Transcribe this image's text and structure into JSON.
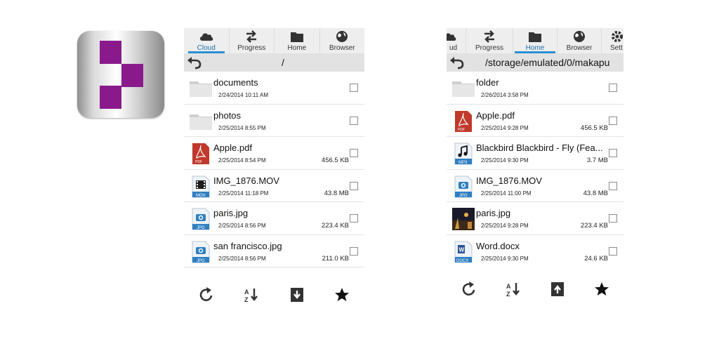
{
  "left_panel": {
    "tabs": [
      {
        "label": "Cloud",
        "icon": "cloud-icon",
        "active": true
      },
      {
        "label": "Progress",
        "icon": "transfer-arrows-icon",
        "active": false
      },
      {
        "label": "Home",
        "icon": "folder-icon",
        "active": false
      },
      {
        "label": "Browser",
        "icon": "globe-icon",
        "active": false
      }
    ],
    "path": "/",
    "files": [
      {
        "name": "documents",
        "date": "2/24/2014 10:11 AM",
        "size": "",
        "icon": "folder-icon"
      },
      {
        "name": "photos",
        "date": "2/25/2014 8:55 PM",
        "size": "",
        "icon": "folder-icon"
      },
      {
        "name": "Apple.pdf",
        "date": "2/25/2014 8:54 PM",
        "size": "456.5 KB",
        "icon": "pdf-file-icon"
      },
      {
        "name": "IMG_1876.MOV",
        "date": "2/25/2014 11:18 PM",
        "size": "43.8 MB",
        "icon": "mov-file-icon"
      },
      {
        "name": "paris.jpg",
        "date": "2/25/2014 8:56 PM",
        "size": "223.4 KB",
        "icon": "jpg-file-icon"
      },
      {
        "name": "san francisco.jpg",
        "date": "2/25/2014 8:56 PM",
        "size": "211.0 KB",
        "icon": "jpg-file-icon"
      }
    ],
    "bottom_actions": [
      "refresh-icon",
      "sort-icon",
      "download-icon",
      "star-icon"
    ]
  },
  "right_panel": {
    "tabs": [
      {
        "label": "ud",
        "icon": "cloud-icon",
        "active": false
      },
      {
        "label": "Progress",
        "icon": "transfer-arrows-icon",
        "active": false
      },
      {
        "label": "Home",
        "icon": "folder-icon",
        "active": true
      },
      {
        "label": "Browser",
        "icon": "globe-icon",
        "active": false
      },
      {
        "label": "Sett",
        "icon": "gear-icon",
        "active": false
      }
    ],
    "path": "/storage/emulated/0/makapu",
    "files": [
      {
        "name": "folder",
        "date": "2/26/2014 3:58 PM",
        "size": "",
        "icon": "folder-icon"
      },
      {
        "name": "Apple.pdf",
        "date": "2/25/2014 9:28 PM",
        "size": "456.5 KB",
        "icon": "pdf-file-icon"
      },
      {
        "name": "Blackbird Blackbird - Fly (Fea...",
        "date": "2/25/2014 9:30 PM",
        "size": "3.7 MB",
        "icon": "mp3-file-icon"
      },
      {
        "name": "IMG_1876.MOV",
        "date": "2/25/2014 11:00 PM",
        "size": "43.8 MB",
        "icon": "jpg-file-icon"
      },
      {
        "name": "paris.jpg",
        "date": "2/25/2014 9:28 PM",
        "size": "223.4 KB",
        "icon": "photo-thumbnail-icon"
      },
      {
        "name": "Word.docx",
        "date": "2/25/2014 9:30 PM",
        "size": "24.6 KB",
        "icon": "docx-file-icon"
      }
    ],
    "bottom_actions": [
      "refresh-icon",
      "sort-icon",
      "upload-icon",
      "star-icon"
    ]
  },
  "colors": {
    "accent_blue": "#2a8fd3",
    "app_icon_purple": "#8a1a8c",
    "pdf_red": "#c0392b"
  }
}
